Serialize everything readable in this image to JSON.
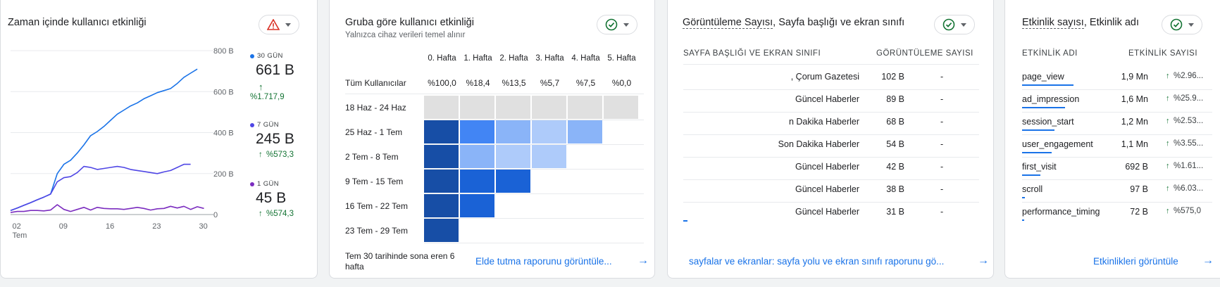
{
  "card1": {
    "title": "Zaman içinde kullanıcı etkinliği",
    "status": "warning",
    "y_ticks": [
      "800 B",
      "600 B",
      "400 B",
      "200 B",
      "0"
    ],
    "x_ticks": [
      "02",
      "09",
      "16",
      "23",
      "30"
    ],
    "x_month": "Tem",
    "legend": [
      {
        "label": "30 GÜN",
        "value": "661 B",
        "change": "%1.717,9",
        "color": "#1a73e8"
      },
      {
        "label": "7 GÜN",
        "value": "245 B",
        "change": "%573,3",
        "color": "#4f46e5"
      },
      {
        "label": "1 GÜN",
        "value": "45 B",
        "change": "%574,3",
        "color": "#7b2cbf"
      }
    ]
  },
  "chart_data": {
    "type": "line",
    "x": [
      1,
      2,
      3,
      4,
      5,
      6,
      7,
      8,
      9,
      10,
      11,
      12,
      13,
      14,
      15,
      16,
      17,
      18,
      19,
      20,
      21,
      22,
      23,
      24,
      25,
      26,
      27,
      28,
      29,
      30,
      31
    ],
    "ylim": [
      0,
      800
    ],
    "x_ticks": [
      "02",
      "09",
      "16",
      "23",
      "30"
    ],
    "series": [
      {
        "name": "30 GÜN",
        "values": [
          20,
          32,
          45,
          58,
          72,
          85,
          100,
          200,
          245,
          265,
          300,
          340,
          385,
          405,
          430,
          460,
          490,
          510,
          530,
          545,
          565,
          580,
          595,
          605,
          615,
          640,
          670,
          690,
          710
        ]
      },
      {
        "name": "7 GÜN",
        "values": [
          20,
          32,
          45,
          58,
          72,
          85,
          100,
          160,
          180,
          185,
          205,
          235,
          230,
          220,
          225,
          230,
          235,
          230,
          220,
          215,
          210,
          205,
          200,
          208,
          215,
          230,
          245,
          245
        ]
      },
      {
        "name": "1 GÜN",
        "values": [
          10,
          15,
          15,
          20,
          20,
          18,
          22,
          48,
          25,
          15,
          25,
          35,
          22,
          35,
          30,
          28,
          28,
          25,
          30,
          35,
          30,
          22,
          28,
          30,
          40,
          32,
          40,
          25,
          38,
          30
        ]
      }
    ]
  },
  "card2": {
    "title": "Gruba göre kullanıcı etkinliği",
    "subtitle": "Yalnızca cihaz verileri temel alınır",
    "status": "ok",
    "columns": [
      "0. Hafta",
      "1. Hafta",
      "2. Hafta",
      "3. Hafta",
      "4. Hafta",
      "5. Hafta"
    ],
    "all_users_label": "Tüm Kullanıcılar",
    "all_users": [
      "%100,0",
      "%18,4",
      "%13,5",
      "%5,7",
      "%7,5",
      "%0,0"
    ],
    "rows": [
      {
        "label": "18 Haz - 24 Haz",
        "cells": [
          0,
          0,
          0,
          0,
          0,
          0
        ]
      },
      {
        "label": "25 Haz - 1 Tem",
        "cells": [
          100,
          30,
          18,
          15,
          17
        ]
      },
      {
        "label": "2 Tem - 8 Tem",
        "cells": [
          100,
          18,
          12,
          10
        ]
      },
      {
        "label": "9 Tem - 15 Tem",
        "cells": [
          100,
          80,
          70
        ]
      },
      {
        "label": "16 Tem - 22 Tem",
        "cells": [
          100,
          75
        ]
      },
      {
        "label": "23 Tem - 29 Tem",
        "cells": [
          100
        ]
      }
    ],
    "footer": "Tem 30 tarihinde sona eren 6 hafta",
    "link": "Elde tutma raporunu görüntüle..."
  },
  "card3": {
    "title_a": "Görüntüleme Sayısı",
    "title_b": ", Sayfa başlığı ve ekran sınıfı",
    "status": "ok",
    "col1": "SAYFA BAŞLIĞI VE EKRAN SINIFI",
    "col2": "GÖRÜNTÜLEME SAYISI",
    "rows": [
      {
        "name": ", Çorum Gazetesi",
        "value": "102 B",
        "change": "-"
      },
      {
        "name": "Güncel Haberler",
        "value": "89 B",
        "change": "-"
      },
      {
        "name": "n Dakika Haberler",
        "value": "68 B",
        "change": "-"
      },
      {
        "name": "Son Dakika Haberler",
        "value": "54 B",
        "change": "-"
      },
      {
        "name": "Güncel Haberler",
        "value": "42 B",
        "change": "-"
      },
      {
        "name": "Güncel Haberler",
        "value": "38 B",
        "change": "-"
      },
      {
        "name": "Güncel Haberler",
        "value": "31 B",
        "change": "-"
      }
    ],
    "link": "sayfalar ve ekranlar: sayfa yolu ve ekran sınıfı raporunu gö..."
  },
  "card4": {
    "title_a": "Etkinlik sayısı",
    "title_b": ", Etkinlik adı",
    "status": "ok",
    "col1": "ETKİNLİK ADI",
    "col2": "ETKİNLİK SAYISI",
    "rows": [
      {
        "name": "page_view",
        "value": "1,9 Mn",
        "change": "%2.96...",
        "bar": 1.0
      },
      {
        "name": "ad_impression",
        "value": "1,6 Mn",
        "change": "%25.9...",
        "bar": 0.84
      },
      {
        "name": "session_start",
        "value": "1,2 Mn",
        "change": "%2.53...",
        "bar": 0.63
      },
      {
        "name": "user_engagement",
        "value": "1,1 Mn",
        "change": "%3.55...",
        "bar": 0.58
      },
      {
        "name": "first_visit",
        "value": "692 B",
        "change": "%1.61...",
        "bar": 0.36
      },
      {
        "name": "scroll",
        "value": "97 B",
        "change": "%6.03...",
        "bar": 0.05
      },
      {
        "name": "performance_timing",
        "value": "72 B",
        "change": "%575,0",
        "bar": 0.04
      }
    ],
    "link": "Etkinlikleri görüntüle"
  }
}
